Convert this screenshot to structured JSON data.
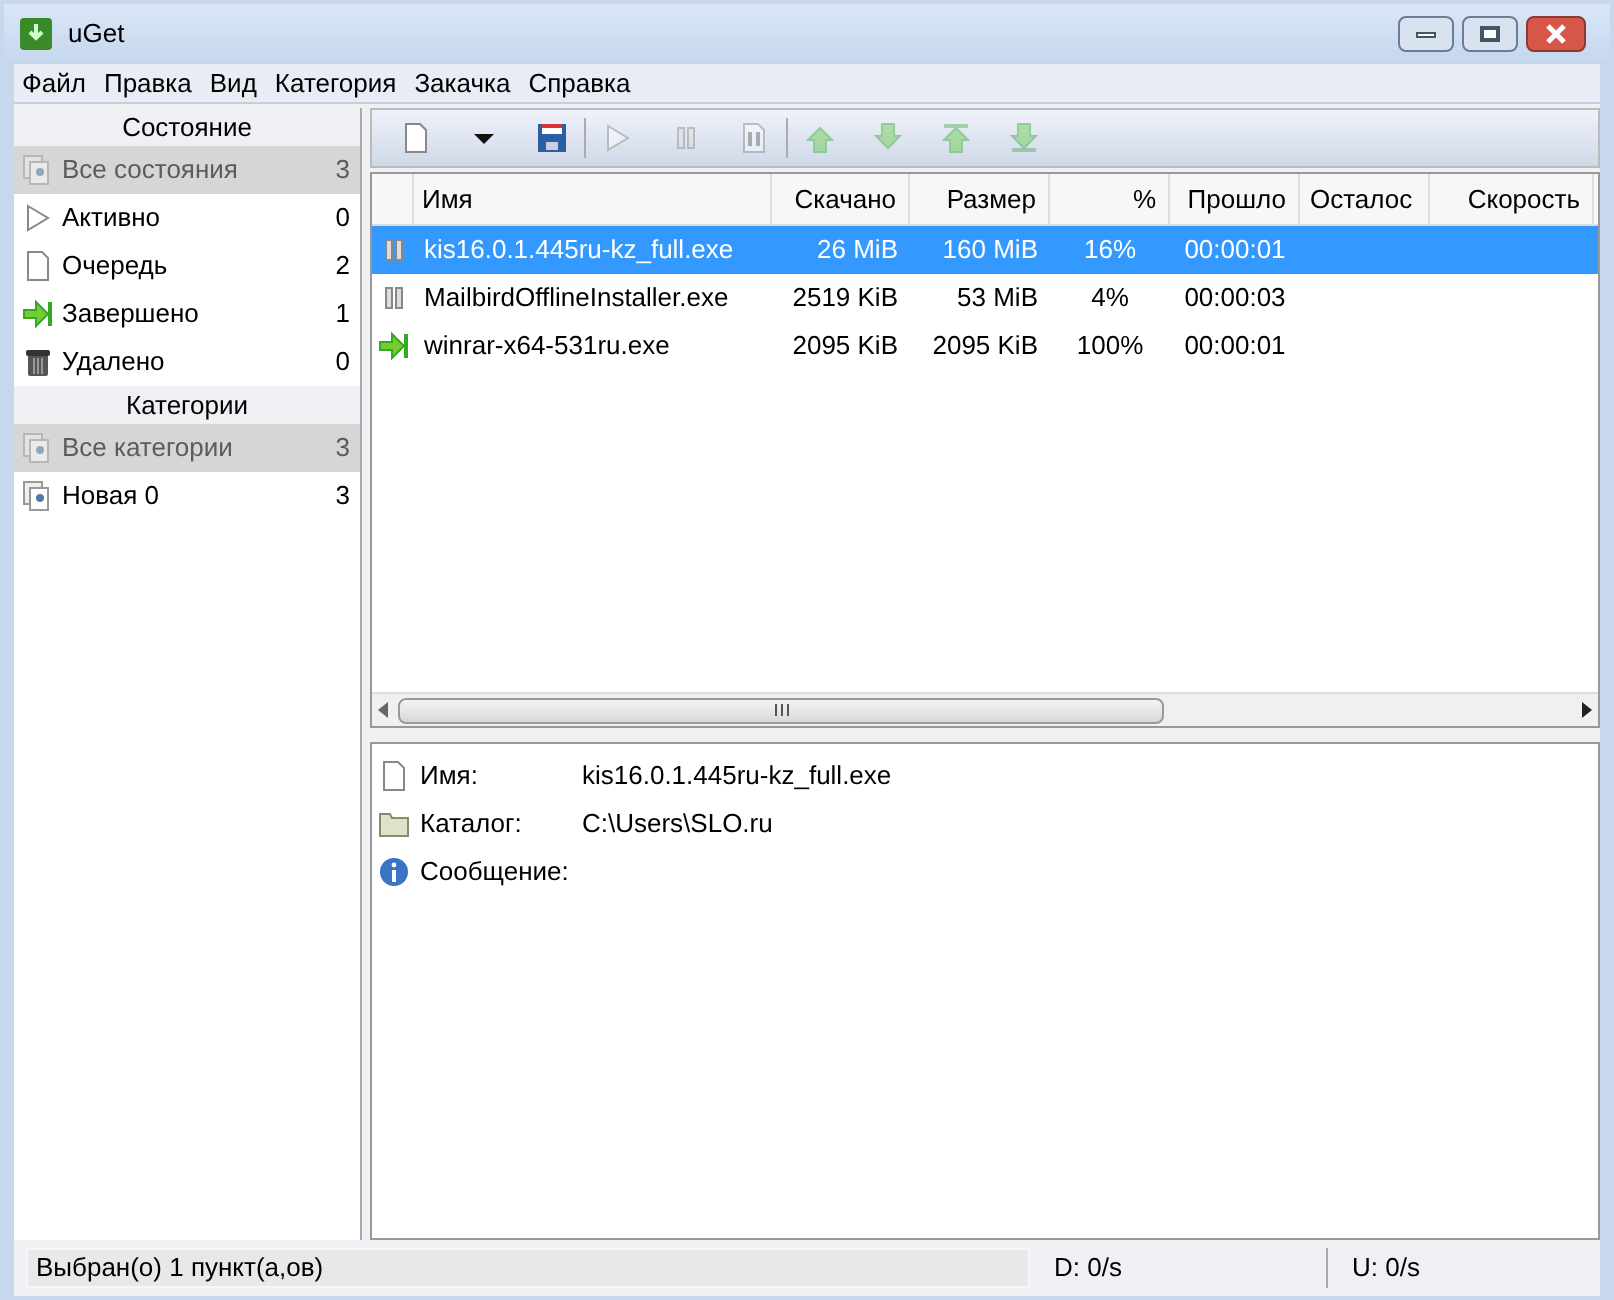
{
  "window": {
    "title": "uGet"
  },
  "menu": [
    "Файл",
    "Правка",
    "Вид",
    "Категория",
    "Закачка",
    "Справка"
  ],
  "toolbar": [
    [
      {
        "kind": "new",
        "disabled": false
      },
      {
        "kind": "dropdown",
        "disabled": false
      },
      {
        "kind": "save",
        "disabled": false
      }
    ],
    [
      {
        "kind": "play",
        "disabled": true
      },
      {
        "kind": "pause",
        "disabled": true
      },
      {
        "kind": "properties",
        "disabled": true
      }
    ],
    [
      {
        "kind": "up",
        "disabled": true
      },
      {
        "kind": "down",
        "disabled": true
      },
      {
        "kind": "top",
        "disabled": true
      },
      {
        "kind": "bottom",
        "disabled": true
      }
    ]
  ],
  "states": {
    "heading": "Состояние",
    "items": [
      {
        "kind": "all",
        "label": "Все состояния",
        "count": "3",
        "selected": true
      },
      {
        "kind": "active",
        "label": "Активно",
        "count": "0",
        "selected": false
      },
      {
        "kind": "queue",
        "label": "Очередь",
        "count": "2",
        "selected": false
      },
      {
        "kind": "done",
        "label": "Завершено",
        "count": "1",
        "selected": false
      },
      {
        "kind": "trash",
        "label": "Удалено",
        "count": "0",
        "selected": false
      }
    ]
  },
  "categories": {
    "heading": "Категории",
    "items": [
      {
        "kind": "all",
        "label": "Все категории",
        "count": "3",
        "selected": true
      },
      {
        "kind": "all",
        "label": "Новая 0",
        "count": "3",
        "selected": false
      }
    ]
  },
  "table": {
    "columns": [
      "Имя",
      "Скачано",
      "Размер",
      "%",
      "Прошло",
      "Осталос",
      "Скорость"
    ],
    "rows": [
      {
        "kind": "paused",
        "selected": true,
        "cells": [
          "kis16.0.1.445ru-kz_full.exe",
          "26 MiB",
          "160 MiB",
          "16%",
          "00:00:01"
        ]
      },
      {
        "kind": "paused",
        "selected": false,
        "cells": [
          "MailbirdOfflineInstaller.exe",
          "2519 KiB",
          "53 MiB",
          "4%",
          "00:00:03"
        ]
      },
      {
        "kind": "done",
        "selected": false,
        "cells": [
          "winrar-x64-531ru.exe",
          "2095 KiB",
          "2095 KiB",
          "100%",
          "00:00:01"
        ]
      }
    ]
  },
  "details": [
    {
      "kind": "file",
      "label": "Имя:",
      "value": "kis16.0.1.445ru-kz_full.exe"
    },
    {
      "kind": "folder",
      "label": "Каталог:",
      "value": "C:\\Users\\SLO.ru"
    },
    {
      "kind": "info",
      "label": "Сообщение:"
    }
  ],
  "status_bar": {
    "selection": "Выбран(о) 1 пункт(а,ов)",
    "download": "D: 0/s",
    "upload": "U: 0/s"
  }
}
